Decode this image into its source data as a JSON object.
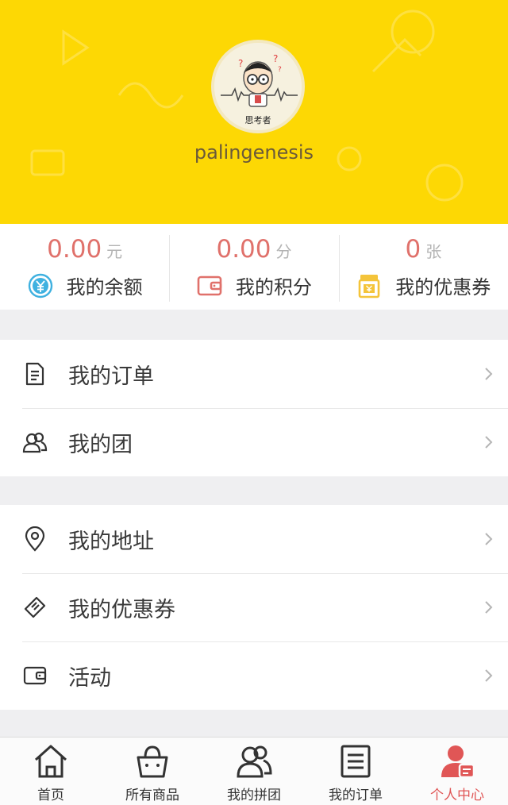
{
  "profile": {
    "username": "palingenesis",
    "avatar_text": "思考者"
  },
  "stats": [
    {
      "value": "0.00",
      "unit": "元",
      "label": "我的余额",
      "icon": "yen-circle-icon"
    },
    {
      "value": "0.00",
      "unit": "分",
      "label": "我的积分",
      "icon": "wallet-icon"
    },
    {
      "value": "0",
      "unit": "张",
      "label": "我的优惠券",
      "icon": "coupon-jar-icon"
    }
  ],
  "menu": {
    "orders_label": "我的订单",
    "groups_label": "我的团",
    "address_label": "我的地址",
    "coupons_label": "我的优惠券",
    "activity_label": "活动"
  },
  "tabbar": {
    "home": "首页",
    "products": "所有商品",
    "my_groups": "我的拼团",
    "my_orders": "我的订单",
    "profile": "个人中心"
  },
  "colors": {
    "header_bg": "#fdd804",
    "accent_red": "#e05656",
    "value_red": "#e0716b"
  }
}
